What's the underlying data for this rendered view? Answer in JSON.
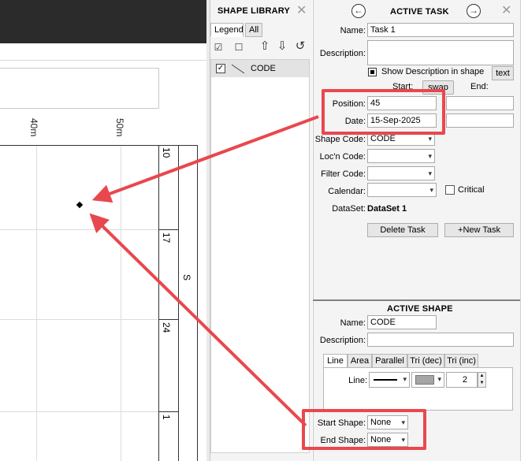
{
  "canvas": {
    "axis_labels": [
      "40m",
      "50m"
    ],
    "day_numbers": [
      "10",
      "17",
      "24",
      "1"
    ],
    "month_label": "S"
  },
  "shape_library": {
    "title": "SHAPE LIBRARY",
    "tabs": [
      {
        "label": "Legend",
        "active": true
      },
      {
        "label": "All",
        "active": false
      }
    ],
    "tool_icons": [
      "checklist-icon",
      "unchecklist-icon",
      "move-up-icon",
      "move-down-icon",
      "undo-icon"
    ],
    "items": [
      {
        "label": "CODE",
        "checked": true
      }
    ]
  },
  "active_task": {
    "title": "ACTIVE TASK",
    "name_label": "Name:",
    "name_value": "Task 1",
    "description_label": "Description:",
    "description_value": "",
    "show_description_label": "Show Description in shape",
    "text_button": "text",
    "start_label": "Start:",
    "swap_button": "swap",
    "end_label": "End:",
    "position_label": "Position:",
    "position_value": "45",
    "date_label": "Date:",
    "date_value": "15-Sep-2025",
    "shape_code_label": "Shape Code:",
    "shape_code_value": "CODE",
    "locn_code_label": "Loc'n Code:",
    "locn_code_value": "",
    "filter_code_label": "Filter Code:",
    "filter_code_value": "",
    "calendar_label": "Calendar:",
    "calendar_value": "",
    "critical_label": "Critical",
    "dataset_label": "DataSet:",
    "dataset_value": "DataSet 1",
    "delete_button": "Delete Task",
    "new_button": "+New Task"
  },
  "active_shape": {
    "title": "ACTIVE SHAPE",
    "name_label": "Name:",
    "name_value": "CODE",
    "description_label": "Description:",
    "description_value": "",
    "tabs": [
      "Line",
      "Area",
      "Parallel",
      "Tri (dec)",
      "Tri (inc)"
    ],
    "line_label": "Line:",
    "line_width": "2",
    "start_shape_label": "Start Shape:",
    "start_shape_value": "None",
    "end_shape_label": "End Shape:",
    "end_shape_value": "None"
  },
  "colors": {
    "highlight": "#e8484d",
    "topbar": "#2b2b2b",
    "panel": "#f4f4f4"
  }
}
